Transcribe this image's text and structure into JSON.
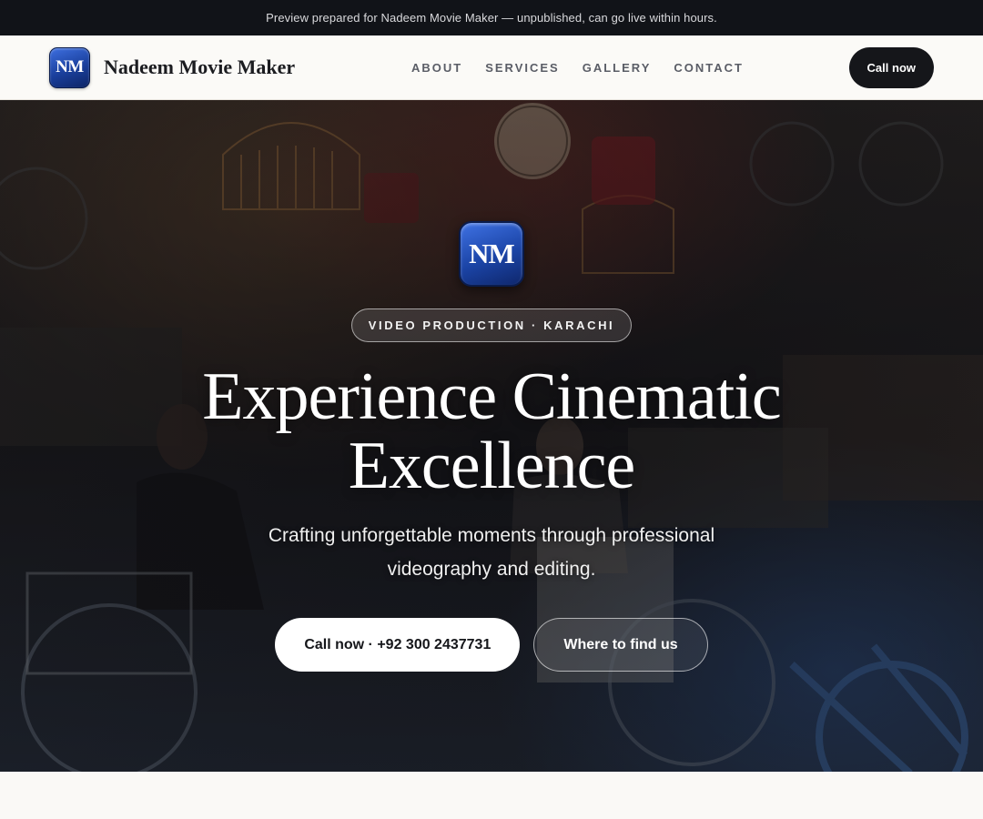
{
  "announcement": {
    "text": "Preview prepared for Nadeem Movie Maker — unpublished, can go live within hours."
  },
  "header": {
    "logo_text": "NM",
    "brand_name": "Nadeem Movie Maker",
    "nav": [
      {
        "label": "ABOUT"
      },
      {
        "label": "SERVICES"
      },
      {
        "label": "GALLERY"
      },
      {
        "label": "CONTACT"
      }
    ],
    "cta_label": "Call now"
  },
  "hero": {
    "logo_text": "NM",
    "tag": "VIDEO PRODUCTION · KARACHI",
    "title": "Experience Cinematic Excellence",
    "subtitle": "Crafting unforgettable moments through professional videography and editing.",
    "primary_cta": "Call now · +92 300 2437731",
    "secondary_cta": "Where to find us"
  },
  "colors": {
    "accent_blue": "#1b44a6",
    "dark": "#15161a",
    "announcement_bg": "#111318",
    "page_bg": "#faf9f6"
  }
}
